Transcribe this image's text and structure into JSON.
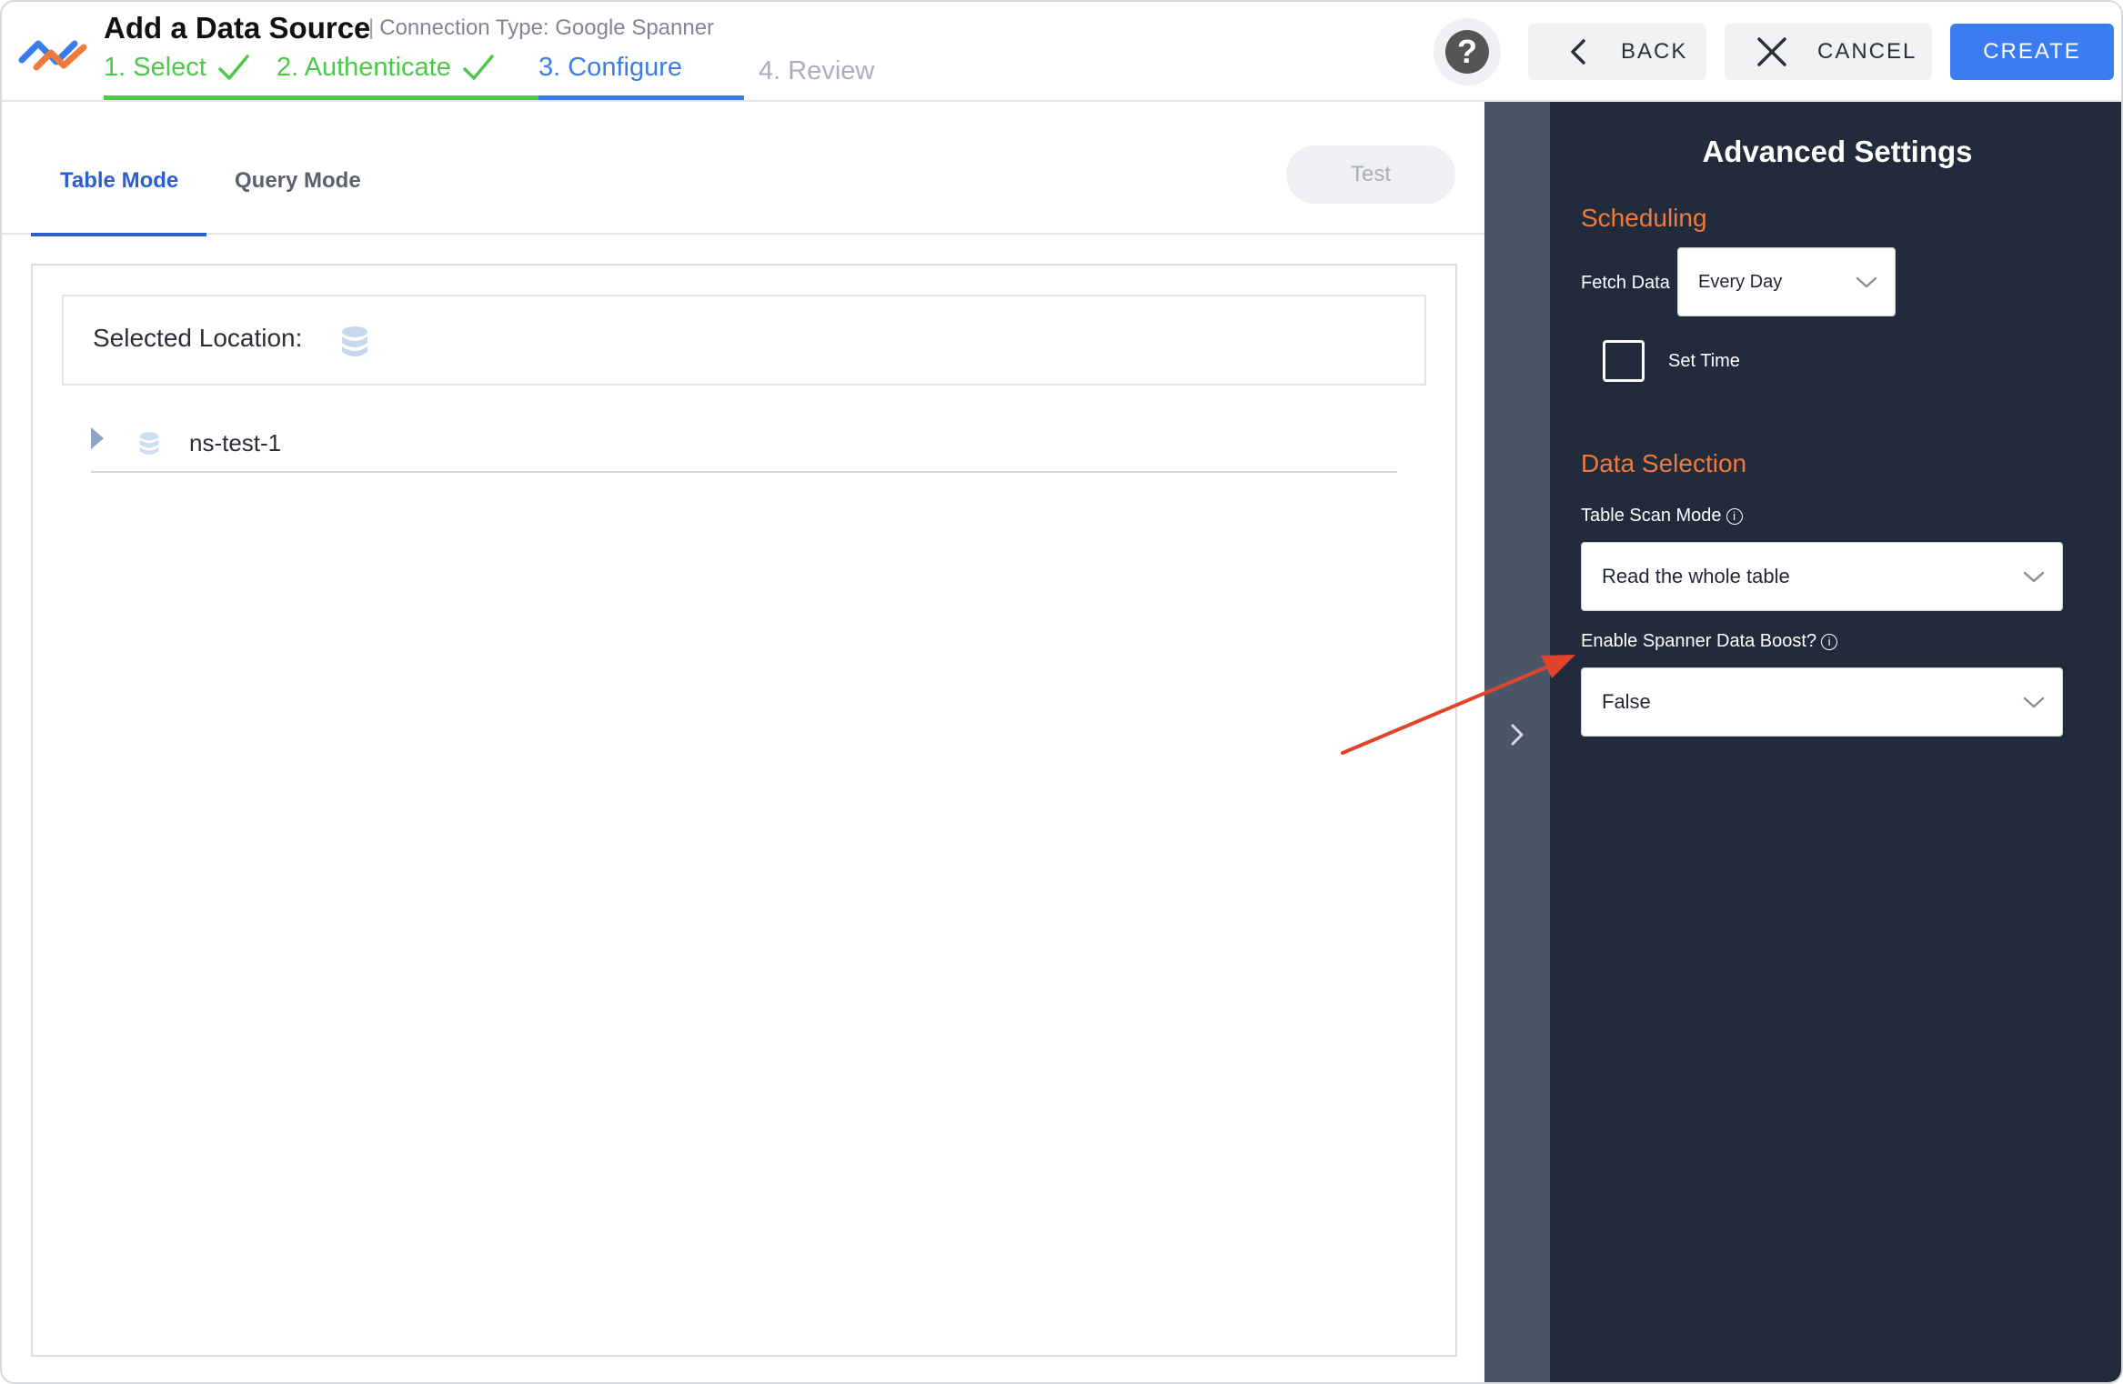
{
  "header": {
    "title": "Add a Data Source",
    "separator": "|",
    "subtitle": "Connection Type: Google Spanner",
    "steps": [
      {
        "label": "1. Select",
        "state": "done"
      },
      {
        "label": "2. Authenticate",
        "state": "done"
      },
      {
        "label": "3. Configure",
        "state": "active"
      },
      {
        "label": "4. Review",
        "state": "pending"
      }
    ],
    "help_glyph": "?",
    "back_label": "BACK",
    "cancel_label": "CANCEL",
    "create_label": "CREATE"
  },
  "main": {
    "tabs": [
      {
        "label": "Table Mode",
        "active": true
      },
      {
        "label": "Query Mode",
        "active": false
      }
    ],
    "test_label": "Test",
    "selected_location_label": "Selected Location:",
    "tree": [
      {
        "label": "ns-test-1",
        "icon": "database-icon",
        "expanded": false
      }
    ]
  },
  "advanced": {
    "title": "Advanced Settings",
    "scheduling": {
      "heading": "Scheduling",
      "fetch_label": "Fetch Data",
      "fetch_value": "Every Day",
      "set_time_label": "Set Time",
      "set_time_checked": false
    },
    "data_selection": {
      "heading": "Data Selection",
      "scan_mode_label": "Table Scan Mode",
      "scan_mode_value": "Read the whole table",
      "boost_label": "Enable Spanner Data Boost?",
      "boost_value": "False",
      "info_glyph": "i"
    }
  },
  "colors": {
    "done": "#4cc94a",
    "active": "#3b7de8",
    "section_heading": "#f07a3c",
    "panel_bg": "#212b3b",
    "annotation_arrow": "#e0452c"
  }
}
